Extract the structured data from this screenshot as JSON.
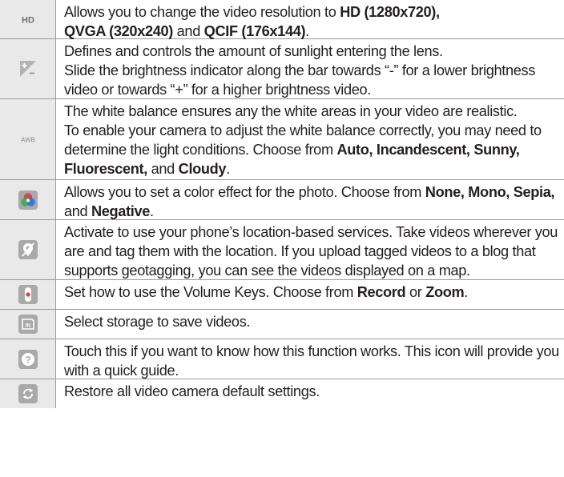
{
  "rows": [
    {
      "icon": "hd-icon",
      "icon_text": "HD",
      "parts": [
        "Allows you to change the video resolution to ",
        "HD (1280x720),",
        " ",
        "QVGA (320x240)",
        " and ",
        "QCIF (176x144)",
        "."
      ]
    },
    {
      "icon": "brightness-icon",
      "parts": [
        "Defines and controls the amount of sunlight entering the lens.",
        " Slide the brightness indicator along the bar towards “-” for a lower brightness video or towards “+” for a higher brightness video."
      ]
    },
    {
      "icon": "white-balance-icon",
      "icon_text": "AWB",
      "parts": [
        "The white balance ensures any the white areas in your video are realistic.",
        " To enable your camera to adjust the white balance correctly, you may need to determine the light conditions. Choose from ",
        "Auto, Incandescent, Sunny, Fluorescent,",
        " and ",
        "Cloudy",
        "."
      ]
    },
    {
      "icon": "color-effect-icon",
      "parts": [
        "Allows you to set a color effect for the photo. Choose from ",
        "None, Mono, Sepia,",
        " and ",
        "Negative",
        "."
      ]
    },
    {
      "icon": "location-icon",
      "parts": [
        "Activate to use your phone’s location-based services. Take videos wherever you are and tag them with the location. If you upload tagged videos to a blog that supports geotagging, you can see the videos displayed on a map."
      ]
    },
    {
      "icon": "volume-key-icon",
      "parts": [
        "Set how to use the Volume Keys. Choose from ",
        "Record",
        " or ",
        "Zoom",
        "."
      ]
    },
    {
      "icon": "storage-icon",
      "icon_text": "IN",
      "parts": [
        "Select storage to save videos."
      ]
    },
    {
      "icon": "help-icon",
      "icon_text": "?",
      "parts": [
        "Touch this if you want to know how this function works. This icon will provide you with a quick guide."
      ]
    },
    {
      "icon": "reset-icon",
      "parts": [
        "Restore all video camera default settings."
      ]
    }
  ],
  "colors": {
    "icon_cell_bg": "#e9e9e9",
    "icon_tile": "#a9a9a9",
    "text": "#231f20",
    "rule": "#9a9a9a"
  }
}
